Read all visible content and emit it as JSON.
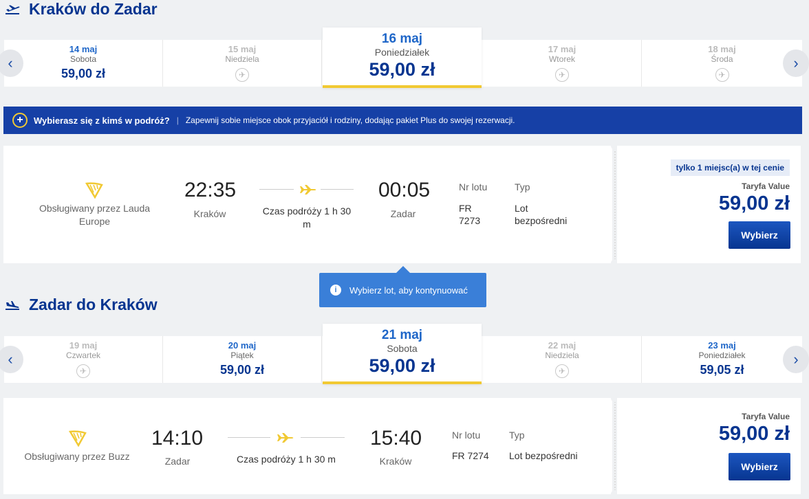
{
  "outbound": {
    "title": "Kraków do Zadar",
    "dates": [
      {
        "date": "14 maj",
        "weekday": "Sobota",
        "price": "59,00 zł"
      },
      {
        "date": "15 maj",
        "weekday": "Niedziela",
        "price": ""
      },
      {
        "date": "16 maj",
        "weekday": "Poniedziałek",
        "price": "59,00 zł"
      },
      {
        "date": "17 maj",
        "weekday": "Wtorek",
        "price": ""
      },
      {
        "date": "18 maj",
        "weekday": "Środa",
        "price": ""
      }
    ],
    "flight": {
      "operator": "Obsługiwany przez Lauda Europe",
      "dep_time": "22:35",
      "dep_city": "Kraków",
      "duration": "Czas podróży 1 h 30 m",
      "arr_time": "00:05",
      "arr_city": "Zadar",
      "flightno_label": "Nr lotu",
      "flightno": "FR 7273",
      "type_label": "Typ",
      "type": "Lot bezpośredni",
      "seats_badge": "tylko 1 miejsc(a) w tej cenie",
      "fare_label": "Taryfa Value",
      "price": "59,00 zł",
      "select": "Wybierz"
    }
  },
  "banner": {
    "title": "Wybierasz się z kimś w podróż?",
    "text": "Zapewnij sobie miejsce obok przyjaciół i rodziny, dodając pakiet Plus do swojej rezerwacji."
  },
  "tooltip": {
    "text": "Wybierz lot, aby kontynuować"
  },
  "return": {
    "title": "Zadar do Kraków",
    "dates": [
      {
        "date": "19 maj",
        "weekday": "Czwartek",
        "price": ""
      },
      {
        "date": "20 maj",
        "weekday": "Piątek",
        "price": "59,00 zł"
      },
      {
        "date": "21 maj",
        "weekday": "Sobota",
        "price": "59,00 zł"
      },
      {
        "date": "22 maj",
        "weekday": "Niedziela",
        "price": ""
      },
      {
        "date": "23 maj",
        "weekday": "Poniedziałek",
        "price": "59,05 zł"
      }
    ],
    "flight": {
      "operator": "Obsługiwany przez Buzz",
      "dep_time": "14:10",
      "dep_city": "Zadar",
      "duration": "Czas podróży 1 h 30 m",
      "arr_time": "15:40",
      "arr_city": "Kraków",
      "flightno_label": "Nr lotu",
      "flightno": "FR 7274",
      "type_label": "Typ",
      "type": "Lot bezpośredni",
      "fare_label": "Taryfa Value",
      "price": "59,00 zł",
      "select": "Wybierz"
    }
  },
  "colors": {
    "brand": "#073590",
    "accent": "#f1c933",
    "banner": "#1640a6",
    "tooltip": "#3a7fd8"
  }
}
